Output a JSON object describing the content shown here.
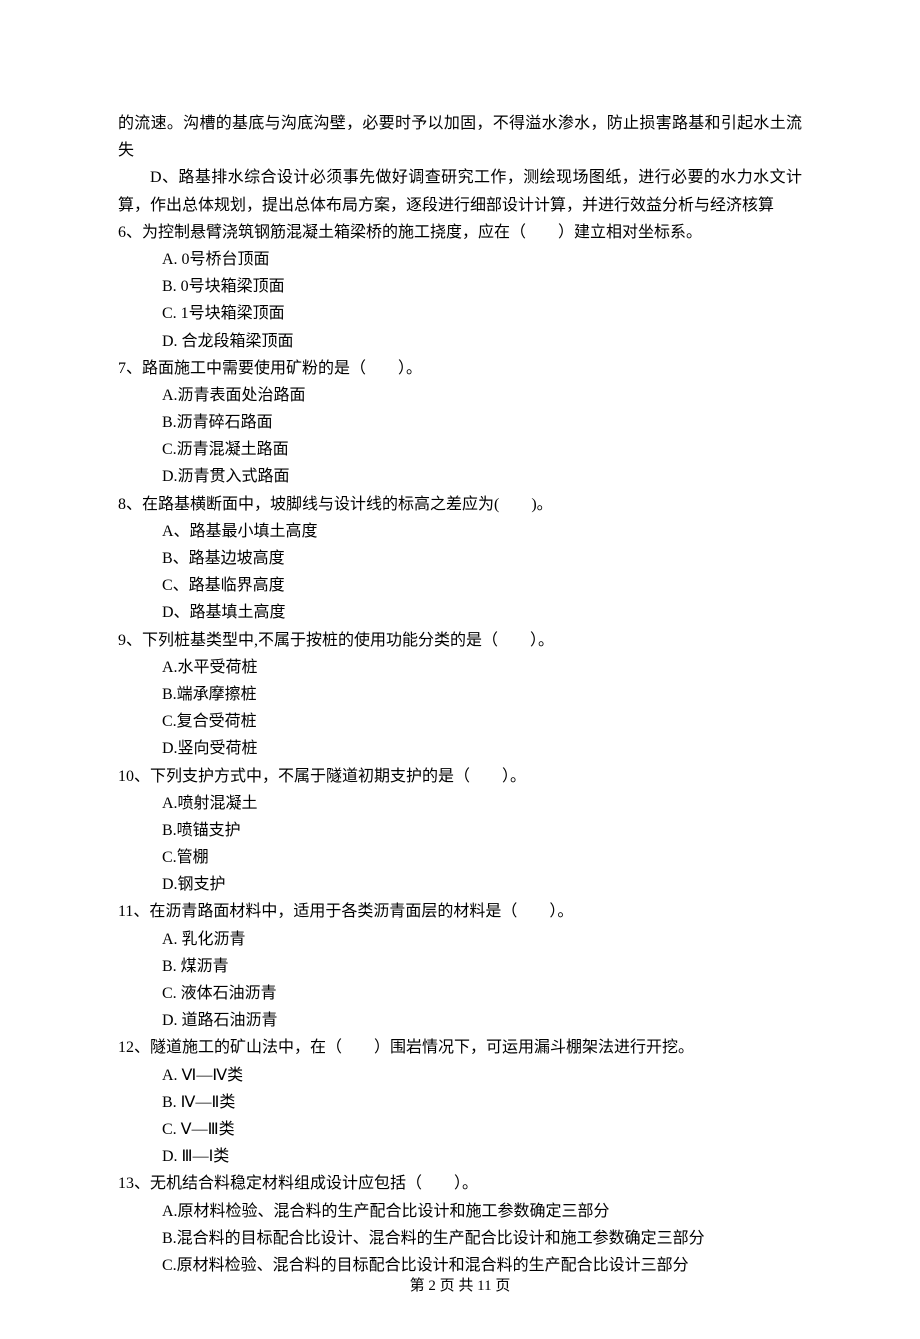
{
  "continuation": {
    "para1": "的流速。沟槽的基底与沟底沟壁，必要时予以加固，不得溢水渗水，防止损害路基和引起水土流失",
    "para2": "D、路基排水综合设计必须事先做好调查研究工作，测绘现场图纸，进行必要的水力水文计算，作出总体规划，提出总体布局方案，逐段进行细部设计计算，并进行效益分析与经济核算"
  },
  "q6": {
    "stem": "6、为控制悬臂浇筑钢筋混凝土箱梁桥的施工挠度，应在（　　）建立相对坐标系。",
    "a": "A. 0号桥台顶面",
    "b": "B. 0号块箱梁顶面",
    "c": "C. 1号块箱梁顶面",
    "d": "D. 合龙段箱梁顶面"
  },
  "q7": {
    "stem": "7、路面施工中需要使用矿粉的是（　　）。",
    "a": "A.沥青表面处治路面",
    "b": "B.沥青碎石路面",
    "c": "C.沥青混凝土路面",
    "d": "D.沥青贯入式路面"
  },
  "q8": {
    "stem": "8、在路基横断面中，坡脚线与设计线的标高之差应为(　　)。",
    "a": "A、路基最小填土高度",
    "b": "B、路基边坡高度",
    "c": "C、路基临界高度",
    "d": "D、路基填土高度"
  },
  "q9": {
    "stem": "9、下列桩基类型中,不属于按桩的使用功能分类的是（　　）。",
    "a": "A.水平受荷桩",
    "b": "B.端承摩擦桩",
    "c": "C.复合受荷桩",
    "d": "D.竖向受荷桩"
  },
  "q10": {
    "stem": "10、下列支护方式中，不属于隧道初期支护的是（　　）。",
    "a": "A.喷射混凝土",
    "b": "B.喷锚支护",
    "c": "C.管棚",
    "d": "D.钢支护"
  },
  "q11": {
    "stem": "11、在沥青路面材料中，适用于各类沥青面层的材料是（　　）。",
    "a": "A. 乳化沥青",
    "b": "B. 煤沥青",
    "c": "C. 液体石油沥青",
    "d": "D. 道路石油沥青"
  },
  "q12": {
    "stem": "12、隧道施工的矿山法中，在（　　）围岩情况下，可运用漏斗棚架法进行开挖。",
    "a": "A. Ⅵ—Ⅳ类",
    "b": "B. Ⅳ—Ⅱ类",
    "c": "C. Ⅴ—Ⅲ类",
    "d": "D. Ⅲ—Ⅰ类"
  },
  "q13": {
    "stem": "13、无机结合料稳定材料组成设计应包括（　　）。",
    "a": "A.原材料检验、混合料的生产配合比设计和施工参数确定三部分",
    "b": "B.混合料的目标配合比设计、混合料的生产配合比设计和施工参数确定三部分",
    "c": "C.原材料检验、混合料的目标配合比设计和混合料的生产配合比设计三部分"
  },
  "footer": "第 2 页 共 11 页"
}
